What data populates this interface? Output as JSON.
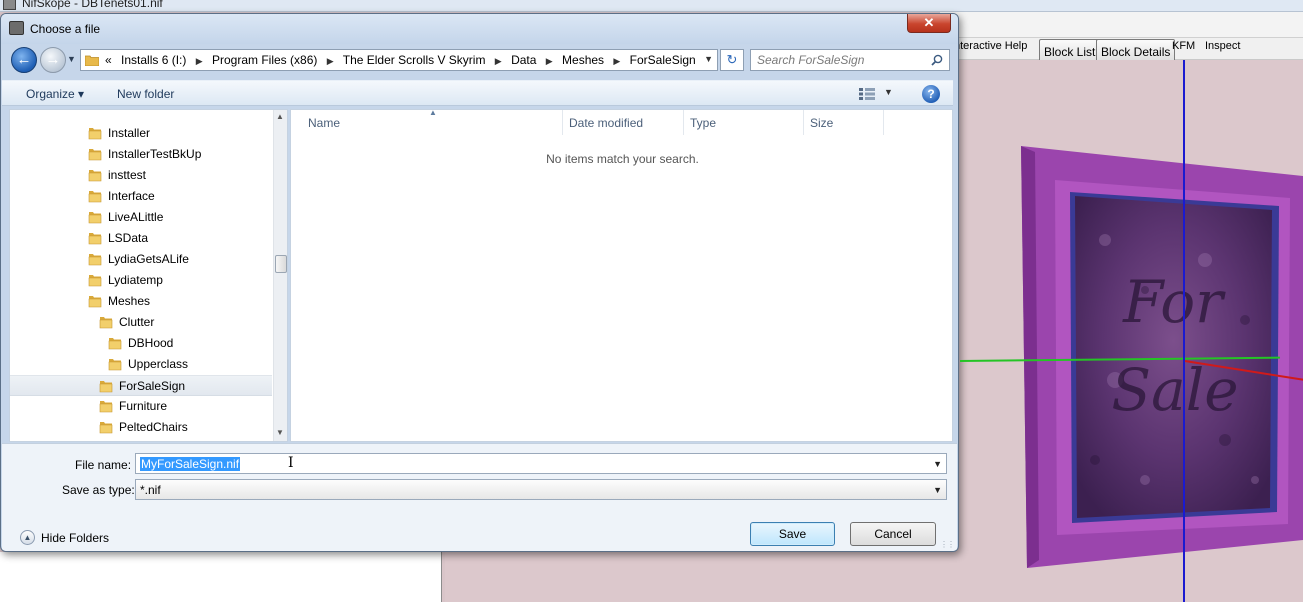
{
  "background_app": {
    "title": "NifSkope - DBTenets01.nif",
    "menu_fragment": "nteractive Help",
    "toolbar": [
      "Block List",
      "Block Details",
      "KFM",
      "Inspect"
    ],
    "sign_text_line1": "For",
    "sign_text_line2": "Sale"
  },
  "dialog": {
    "title": "Choose a file",
    "close_glyph": "✕",
    "address": {
      "prefix": "«",
      "crumbs": [
        "Installs 6 (I:)",
        "Program Files (x86)",
        "The Elder Scrolls V Skyrim",
        "Data",
        "Meshes",
        "ForSaleSign"
      ]
    },
    "search_placeholder": "Search ForSaleSign",
    "commands": {
      "organize": "Organize ▾",
      "new_folder": "New folder"
    },
    "nav_tree": [
      {
        "label": "Installer",
        "level": 0,
        "selected": false
      },
      {
        "label": "InstallerTestBkUp",
        "level": 0,
        "selected": false
      },
      {
        "label": "insttest",
        "level": 0,
        "selected": false
      },
      {
        "label": "Interface",
        "level": 0,
        "selected": false
      },
      {
        "label": "LiveALittle",
        "level": 0,
        "selected": false
      },
      {
        "label": "LSData",
        "level": 0,
        "selected": false
      },
      {
        "label": "LydiaGetsALife",
        "level": 0,
        "selected": false
      },
      {
        "label": "Lydiatemp",
        "level": 0,
        "selected": false
      },
      {
        "label": "Meshes",
        "level": 0,
        "selected": false
      },
      {
        "label": "Clutter",
        "level": 1,
        "selected": false
      },
      {
        "label": "DBHood",
        "level": 2,
        "selected": false
      },
      {
        "label": "Upperclass",
        "level": 2,
        "selected": false
      },
      {
        "label": "ForSaleSign",
        "level": 1,
        "selected": true
      },
      {
        "label": "Furniture",
        "level": 1,
        "selected": false
      },
      {
        "label": "PeltedChairs",
        "level": 1,
        "selected": false
      }
    ],
    "columns": [
      "Name",
      "Date modified",
      "Type",
      "Size"
    ],
    "empty_message": "No items match your search.",
    "file_name_label": "File name:",
    "file_name_value": "MyForSaleSign.nif",
    "save_as_type_label": "Save as type:",
    "save_as_type_value": "*.nif",
    "hide_folders": "Hide Folders",
    "save_button": "Save",
    "cancel_button": "Cancel"
  },
  "colors": {
    "sign_frame": "#a64fb5",
    "sign_dark": "#4a2a60",
    "axis_blue": "#1a1ad0",
    "axis_green": "#25c425",
    "axis_red": "#d01a1a",
    "selection": "#3399ff"
  },
  "icons": [
    "folder-icon",
    "search-icon",
    "refresh-icon",
    "back-arrow-icon",
    "forward-arrow-icon",
    "help-icon",
    "views-icon",
    "close-icon"
  ]
}
